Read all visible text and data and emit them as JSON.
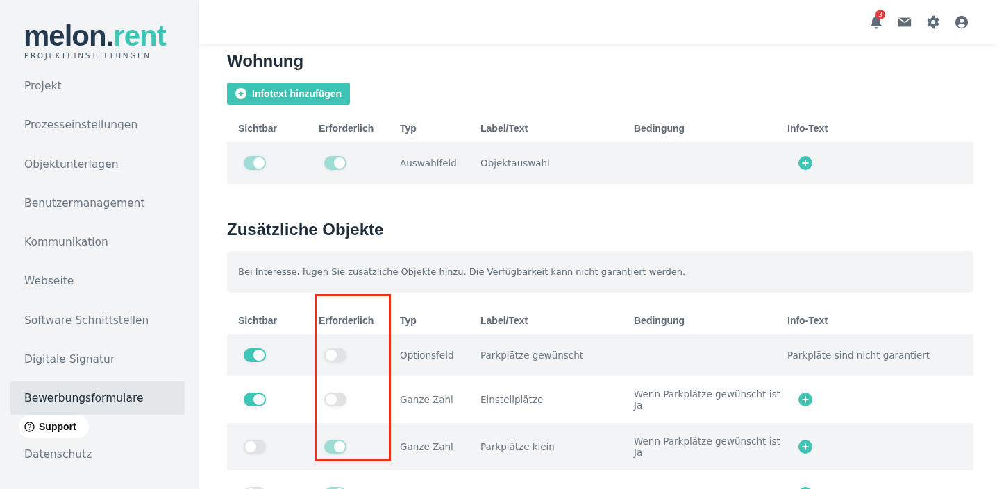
{
  "sidebar": {
    "logo": {
      "part_1": "melon.",
      "part_2": "rent"
    },
    "subtitle": "PROJEKTEINSTELLUNGEN",
    "items": [
      {
        "label": "Projekt",
        "selected": false
      },
      {
        "label": "Prozesseinstellungen",
        "selected": false
      },
      {
        "label": "Objektunterlagen",
        "selected": false
      },
      {
        "label": "Benutzermanagement",
        "selected": false
      },
      {
        "label": "Kommunikation",
        "selected": false
      },
      {
        "label": "Webseite",
        "selected": false
      },
      {
        "label": "Software Schnittstellen",
        "selected": false
      },
      {
        "label": "Digitale Signatur",
        "selected": false
      },
      {
        "label": "Bewerbungsformulare",
        "selected": true
      },
      {
        "label": "Datenschutz",
        "selected": false
      }
    ],
    "support_button": "Support"
  },
  "topbar": {
    "notification_count": "3"
  },
  "sections": [
    {
      "title": "Wohnung",
      "add_button": "Infotext hinzufügen",
      "columns": [
        {
          "label": "Sichtbar",
          "highlighted": false
        },
        {
          "label": "Erforderlich",
          "highlighted": false
        },
        {
          "label": "Typ",
          "highlighted": false
        },
        {
          "label": "Label/Text",
          "highlighted": false
        },
        {
          "label": "Bedingung",
          "highlighted": false
        },
        {
          "label": "Info-Text",
          "highlighted": false
        }
      ],
      "rows": [
        {
          "visible": {
            "on": true,
            "disabled": true
          },
          "required": {
            "on": true,
            "disabled": true
          },
          "type": "Auswahlfeld",
          "label": "Objektauswahl"
        }
      ]
    },
    {
      "title": "Zusätzliche Objekte",
      "note": "Bei Interesse, fügen Sie zusätzliche Objekte hinzu. Die Verfügbarkeit kann nicht garantiert werden.",
      "columns": [
        {
          "label": "Sichtbar",
          "highlighted": false
        },
        {
          "label": "Erforderlich",
          "highlighted": true
        },
        {
          "label": "Typ",
          "highlighted": false
        },
        {
          "label": "Label/Text",
          "highlighted": false
        },
        {
          "label": "Bedingung",
          "highlighted": false
        },
        {
          "label": "Info-Text",
          "highlighted": false
        }
      ],
      "rows": [
        {
          "visible": {
            "on": true,
            "disabled": false
          },
          "required": {
            "on": false,
            "disabled": false
          },
          "type": "Optionsfeld",
          "label": "Parkplätze gewünscht",
          "info_text": "Parkpläte sind nicht garantiert"
        },
        {
          "visible": {
            "on": true,
            "disabled": false
          },
          "required": {
            "on": false,
            "disabled": false
          },
          "type": "Ganze Zahl",
          "label": "Einstellplätze",
          "condition": "Wenn Parkplätze gewünscht ist Ja"
        },
        {
          "visible": {
            "on": false,
            "disabled": false
          },
          "required": {
            "on": true,
            "disabled": true
          },
          "type": "Ganze Zahl",
          "label": "Parkplätze klein",
          "condition": "Wenn Parkplätze gewünscht ist Ja"
        },
        {
          "visible": {
            "on": false,
            "disabled": false
          },
          "required": {
            "on": true,
            "disabled": true
          }
        }
      ]
    }
  ]
}
